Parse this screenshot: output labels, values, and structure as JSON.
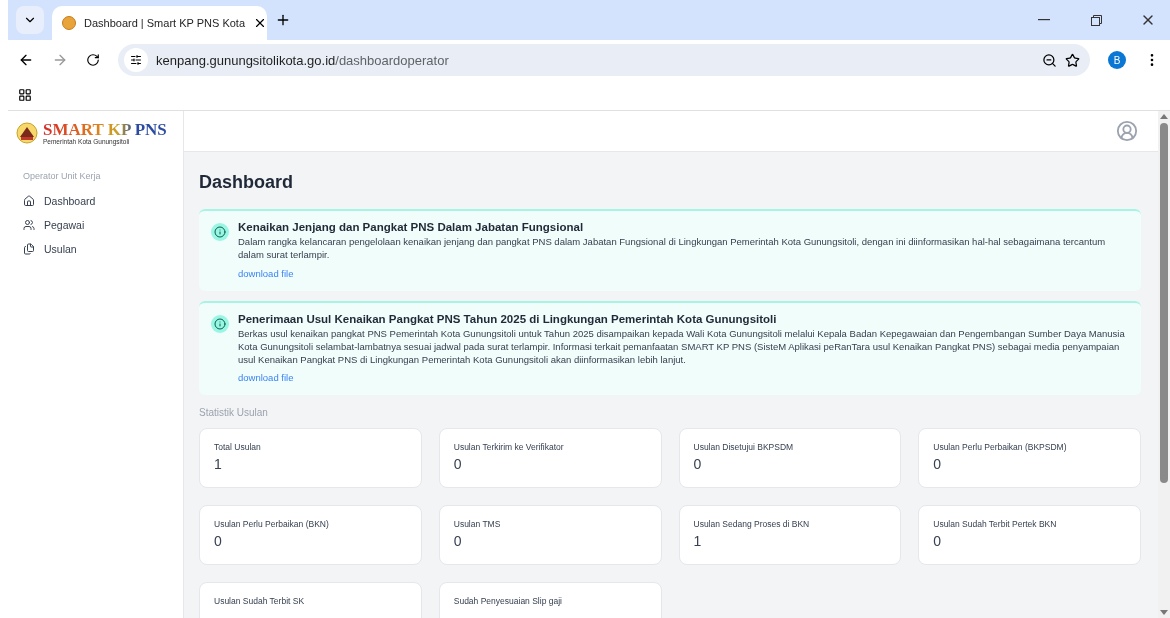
{
  "browser": {
    "tab_title": "Dashboard | Smart KP PNS Kota",
    "url_host": "kenpang.gunungsitolikota.go.id",
    "url_path": "/dashboardoperator",
    "profile_initial": "B"
  },
  "sidebar": {
    "logo_title": "SMART KP PNS",
    "logo_subtitle": "Pemerintah Kota Gunungsitoli",
    "section": "Operator Unit Kerja",
    "items": [
      {
        "label": "Dashboard",
        "kind": "home"
      },
      {
        "label": "Pegawai",
        "kind": "users"
      },
      {
        "label": "Usulan",
        "kind": "files"
      }
    ]
  },
  "page_title": "Dashboard",
  "announcements": [
    {
      "title": "Kenaikan Jenjang dan Pangkat PNS Dalam Jabatan Fungsional",
      "body": "Dalam rangka kelancaran pengelolaan kenaikan jenjang dan pangkat PNS dalam Jabatan Fungsional di Lingkungan Pemerintah Kota Gunungsitoli, dengan ini diinformasikan hal-hal sebagaimana tercantum dalam surat terlampir.",
      "link": "download file"
    },
    {
      "title": "Penerimaan Usul Kenaikan Pangkat PNS Tahun 2025 di Lingkungan Pemerintah Kota Gunungsitoli",
      "body": "Berkas usul kenaikan pangkat PNS Pemerintah Kota Gunungsitoli untuk Tahun 2025 disampaikan kepada Wali Kota Gunungsitoli melalui Kepala Badan Kepegawaian dan Pengembangan Sumber Daya Manusia Kota Gunungsitoli selambat-lambatnya sesuai jadwal pada surat terlampir. Informasi terkait pemanfaatan SMART KP PNS (SisteM Aplikasi peRanTara usul Kenaikan Pangkat PNS) sebagai media penyampaian usul Kenaikan Pangkat PNS di Lingkungan Pemerintah Kota Gunungsitoli akan diinformasikan lebih lanjut.",
      "link": "download file"
    }
  ],
  "stats_heading": "Statistik Usulan",
  "stats": [
    {
      "label": "Total Usulan",
      "value": "1"
    },
    {
      "label": "Usulan Terkirim ke Verifikator",
      "value": "0"
    },
    {
      "label": "Usulan Disetujui BKPSDM",
      "value": "0"
    },
    {
      "label": "Usulan Perlu Perbaikan (BKPSDM)",
      "value": "0"
    },
    {
      "label": "Usulan Perlu Perbaikan (BKN)",
      "value": "0"
    },
    {
      "label": "Usulan TMS",
      "value": "0"
    },
    {
      "label": "Usulan Sedang Proses di BKN",
      "value": "1"
    },
    {
      "label": "Usulan Sudah Terbit Pertek BKN",
      "value": "0"
    },
    {
      "label": "Usulan Sudah Terbit SK"
    },
    {
      "label": "Sudah Penyesuaian Slip gaji"
    }
  ]
}
